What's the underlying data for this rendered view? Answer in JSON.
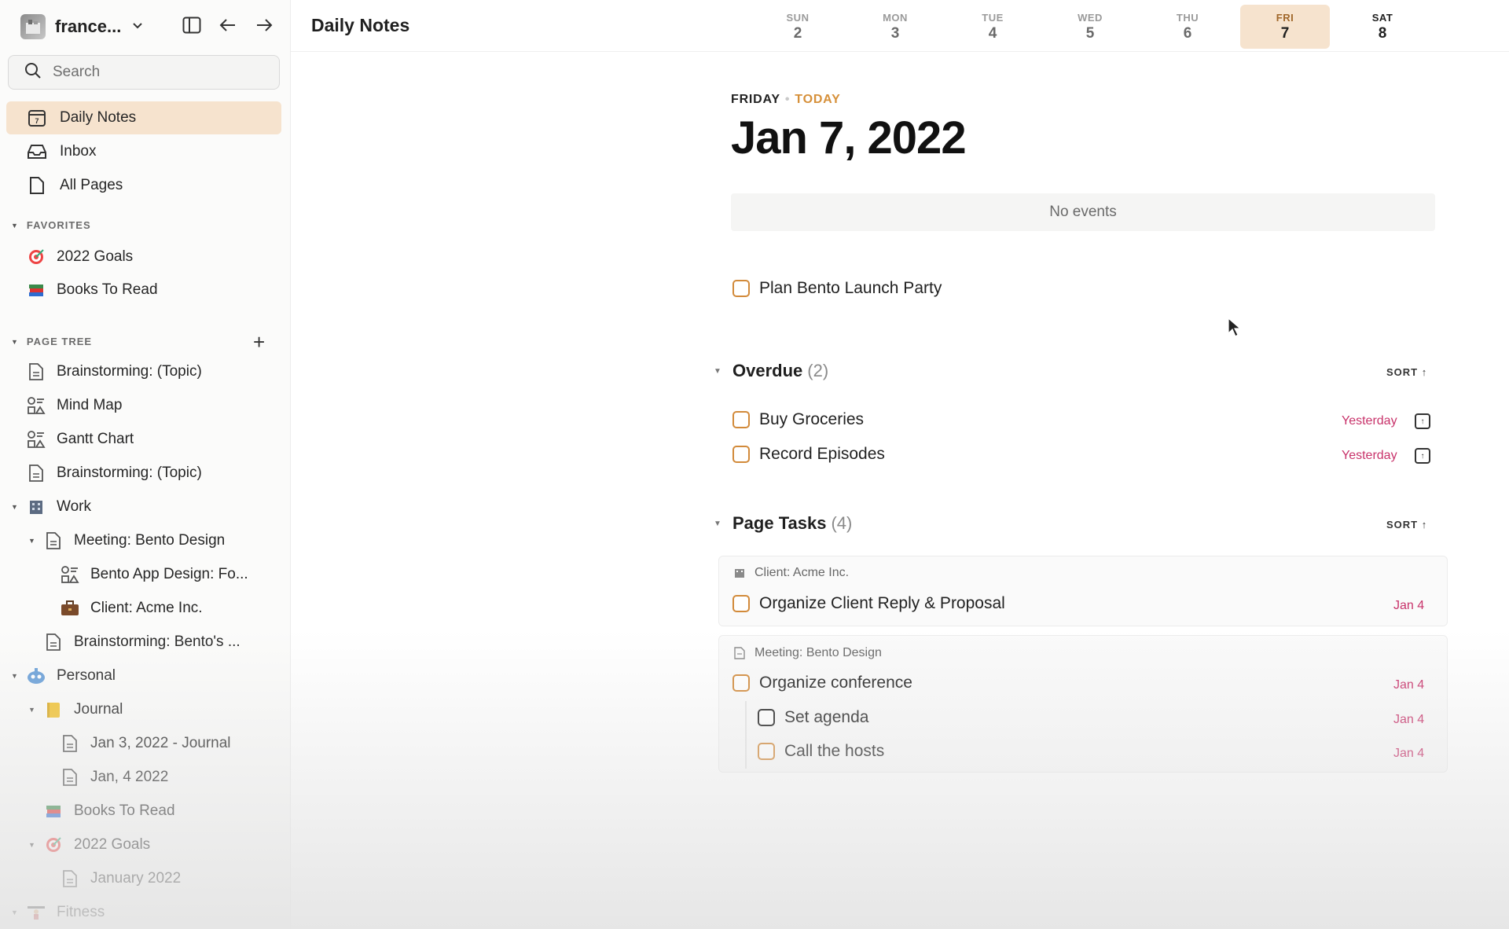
{
  "workspace": {
    "name": "france...",
    "avatar_icon": "workspace-avatar"
  },
  "search": {
    "placeholder": "Search"
  },
  "nav": [
    {
      "label": "Daily Notes",
      "icon": "calendar-icon",
      "active": true
    },
    {
      "label": "Inbox",
      "icon": "inbox-icon",
      "active": false
    },
    {
      "label": "All Pages",
      "icon": "page-icon",
      "active": false
    }
  ],
  "favorites": {
    "title": "FAVORITES",
    "items": [
      {
        "label": "2022 Goals",
        "icon": "target-emoji-icon"
      },
      {
        "label": "Books To Read",
        "icon": "books-emoji-icon"
      }
    ]
  },
  "page_tree": {
    "title": "PAGE TREE",
    "items": [
      {
        "label": "Brainstorming: (Topic)",
        "icon": "document-icon"
      },
      {
        "label": "Mind Map",
        "icon": "shapes-icon"
      },
      {
        "label": "Gantt Chart",
        "icon": "shapes-icon"
      },
      {
        "label": "Brainstorming: (Topic)",
        "icon": "document-icon"
      },
      {
        "label": "Work",
        "icon": "building-emoji-icon"
      },
      {
        "label": "Meeting: Bento Design",
        "icon": "document-icon"
      },
      {
        "label": "Bento App Design: Fo...",
        "icon": "shapes-icon"
      },
      {
        "label": "Client: Acme Inc.",
        "icon": "briefcase-emoji-icon"
      },
      {
        "label": "Brainstorming: Bento's ...",
        "icon": "document-icon"
      },
      {
        "label": "Personal",
        "icon": "robot-emoji-icon"
      },
      {
        "label": "Journal",
        "icon": "notebook-emoji-icon"
      },
      {
        "label": "Jan 3, 2022 - Journal",
        "icon": "document-icon"
      },
      {
        "label": "Jan, 4 2022",
        "icon": "document-icon"
      },
      {
        "label": "Books To Read",
        "icon": "books-emoji-icon"
      },
      {
        "label": "2022 Goals",
        "icon": "target-emoji-icon"
      },
      {
        "label": "January 2022",
        "icon": "document-icon"
      },
      {
        "label": "Fitness",
        "icon": "weightlifter-emoji-icon"
      }
    ]
  },
  "header": {
    "title": "Daily Notes",
    "week": [
      {
        "name": "SUN",
        "num": "2"
      },
      {
        "name": "MON",
        "num": "3"
      },
      {
        "name": "TUE",
        "num": "4"
      },
      {
        "name": "WED",
        "num": "5"
      },
      {
        "name": "THU",
        "num": "6"
      },
      {
        "name": "FRI",
        "num": "7"
      },
      {
        "name": "SAT",
        "num": "8"
      }
    ]
  },
  "day": {
    "weekday": "FRIDAY",
    "today": "TODAY",
    "date": "Jan 7, 2022",
    "no_events": "No events"
  },
  "tasks": {
    "top": "Plan Bento Launch Party"
  },
  "overdue": {
    "title": "Overdue",
    "count": "(2)",
    "sort": "SORT ↑",
    "items": [
      {
        "label": "Buy Groceries",
        "due": "Yesterday"
      },
      {
        "label": "Record Episodes",
        "due": "Yesterday"
      }
    ]
  },
  "page_tasks": {
    "title": "Page Tasks",
    "count": "(4)",
    "sort": "SORT ↑",
    "groups": [
      {
        "label": "Client: Acme Inc.",
        "items": [
          {
            "label": "Organize Client Reply & Proposal",
            "due": "Jan 4"
          }
        ]
      },
      {
        "label": "Meeting: Bento Design",
        "items": [
          {
            "label": "Organize conference",
            "due": "Jan 4"
          },
          {
            "label": "Set agenda",
            "due": "Jan 4"
          },
          {
            "label": "Call the hosts",
            "due": "Jan 4"
          }
        ]
      }
    ]
  },
  "colors": {
    "accent": "#f6e3ce",
    "today": "#d6903a",
    "due": "#c8326a",
    "checkbox": "#d28a3a"
  }
}
